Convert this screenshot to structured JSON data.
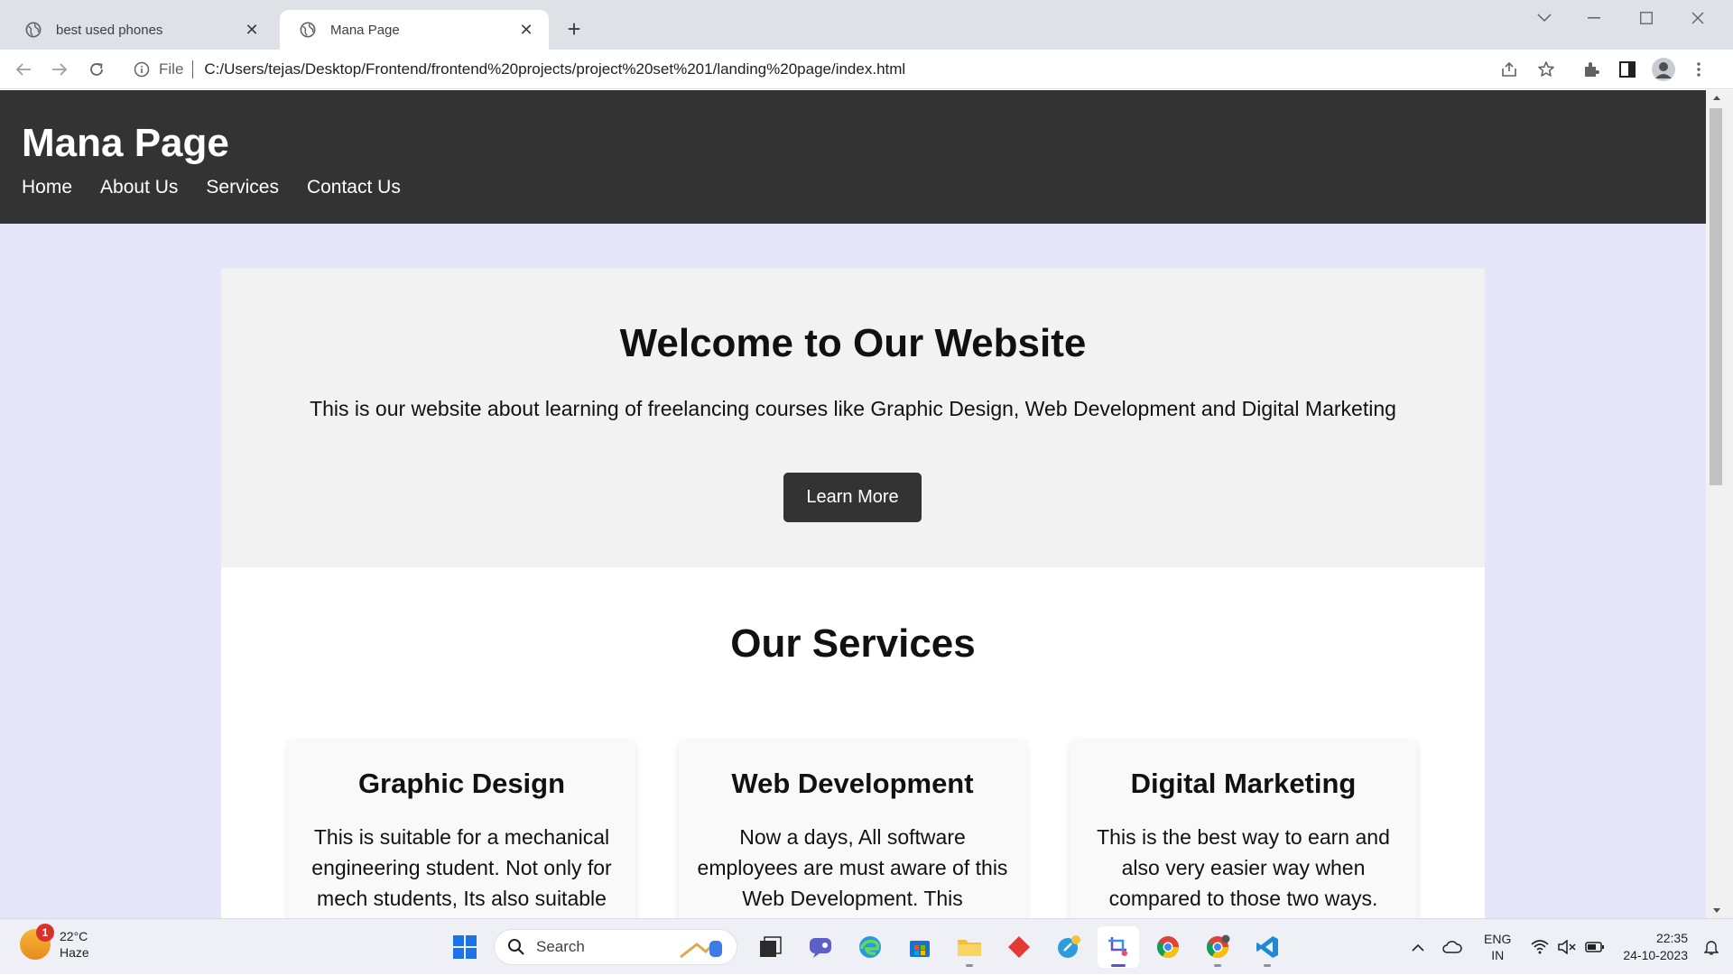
{
  "browser": {
    "tabs": [
      {
        "title": "best used phones",
        "active": false
      },
      {
        "title": "Mana Page",
        "active": true
      }
    ],
    "address": {
      "scheme": "File",
      "url": "C:/Users/tejas/Desktop/Frontend/frontend%20projects/project%20set%201/landing%20page/index.html"
    }
  },
  "site": {
    "title": "Mana Page",
    "nav": [
      "Home",
      "About Us",
      "Services",
      "Contact Us"
    ],
    "hero": {
      "heading": "Welcome to Our Website",
      "text": "This is our website about learning of freelancing courses like Graphic Design, Web Development and Digital Marketing",
      "button": "Learn More"
    },
    "services": {
      "heading": "Our Services",
      "cards": [
        {
          "title": "Graphic Design",
          "text": "This is suitable for a mechanical engineering student. Not only for mech students, Its also suitable"
        },
        {
          "title": "Web Development",
          "text": "Now a days, All software employees are must aware of this Web Development. This"
        },
        {
          "title": "Digital Marketing",
          "text": "This is the best way to earn and also very easier way when compared to those two ways."
        }
      ]
    }
  },
  "taskbar": {
    "weather": {
      "temp": "22°C",
      "condition": "Haze",
      "badge": "1"
    },
    "search_label": "Search",
    "language": {
      "line1": "ENG",
      "line2": "IN"
    },
    "clock": {
      "time": "22:35",
      "date": "24-10-2023"
    }
  },
  "colors": {
    "header_bg": "#333333",
    "page_bg": "#e6e6fa",
    "hero_bg": "#f2f2f2",
    "button_bg": "#333333"
  }
}
